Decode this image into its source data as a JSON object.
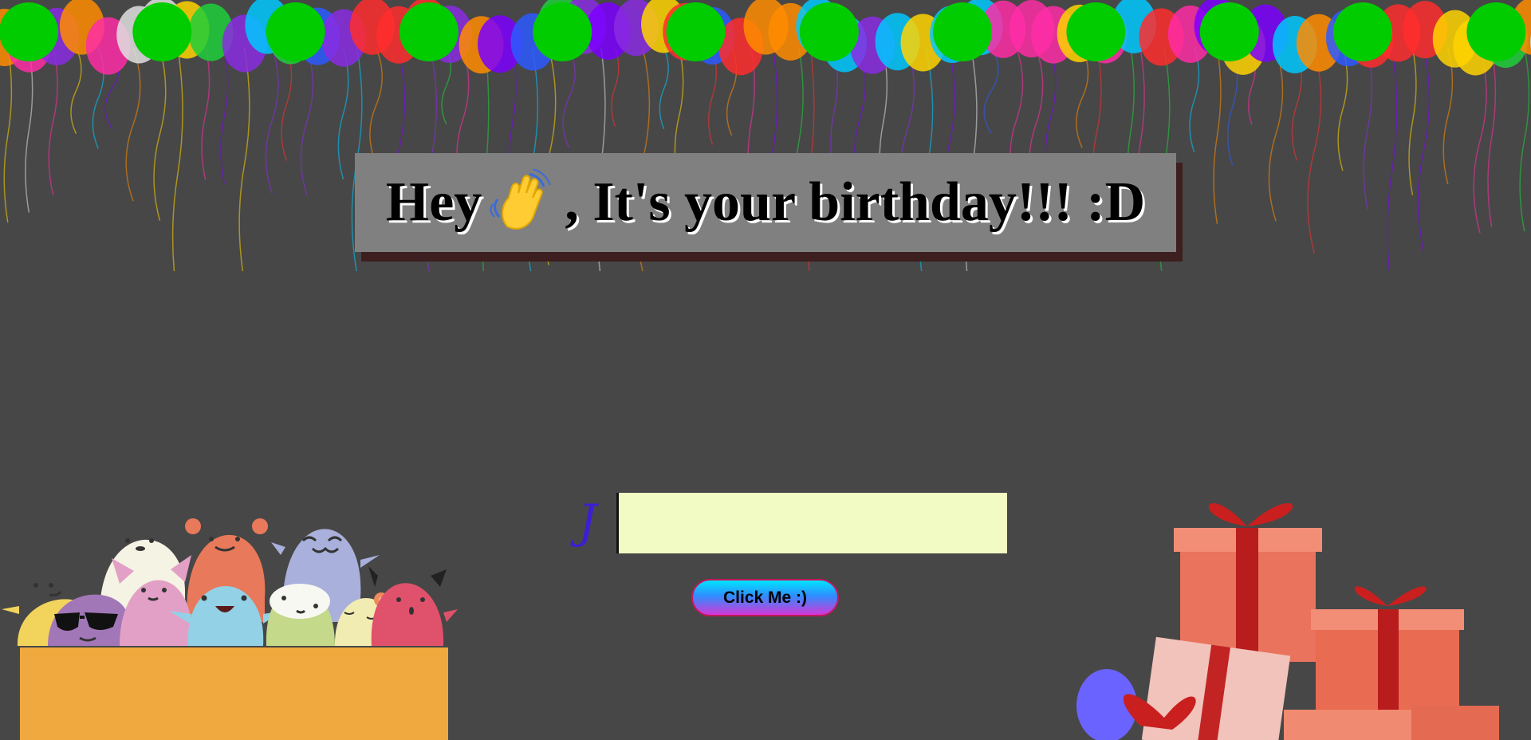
{
  "header": {
    "title_before": "Hey",
    "title_after": ", It's your birthday!!! :D",
    "wave_icon": "waving-hand-icon"
  },
  "form": {
    "cursive_mark": "J",
    "name_value": "",
    "button_label": "Click Me :)"
  },
  "colors": {
    "background": "#474747",
    "title_box": "#808080",
    "title_shadow": "#3d1f1f",
    "input_bg": "#f3fbc4",
    "green_balloon": "#00cc00",
    "box_orange": "#f0a93e"
  }
}
